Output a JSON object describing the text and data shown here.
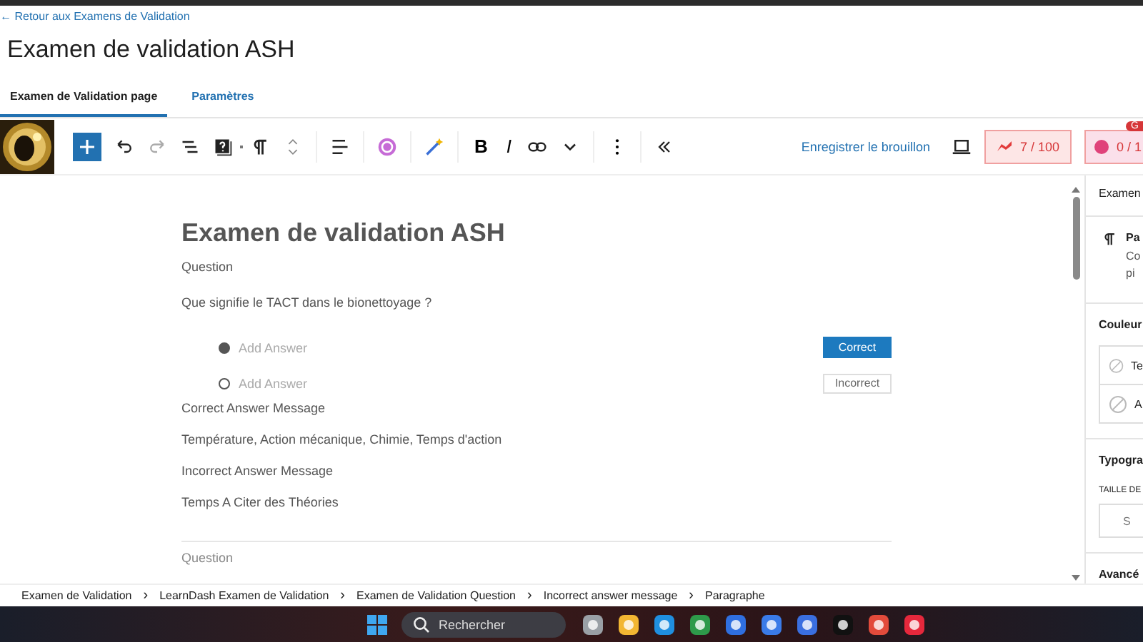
{
  "back_link": "← Retour aux Examens de Validation",
  "title": "Examen de validation ASH",
  "tabs": [
    {
      "label": "Examen de Validation page",
      "selected": true
    },
    {
      "label": "Paramètres",
      "selected": false
    }
  ],
  "toolbar": {
    "bold": "B",
    "italic": "I",
    "save_draft": "Enregistrer le brouillon",
    "score_1": "7 / 100",
    "score_2": "0 / 1",
    "badge": "G"
  },
  "editor": {
    "heading": "Examen de validation ASH",
    "question_label": "Question",
    "question": "Que signifie le TACT dans le bionettoyage ?",
    "answers": [
      {
        "placeholder": "Add Answer",
        "checked": true,
        "button": "Correct"
      },
      {
        "placeholder": "Add Answer",
        "checked": false,
        "button": "Incorrect"
      }
    ],
    "paragraphs": [
      "Correct Answer Message",
      "Température, Action mécanique, Chimie, Temps d'action",
      "Incorrect Answer Message",
      "Temps A Citer des Théories"
    ],
    "next_label": "Question"
  },
  "sidebar": {
    "tab": "Examen",
    "block_title": "Pa",
    "block_desc_1": "Co",
    "block_desc_2": "pi",
    "color_heading": "Couleur",
    "color_items": [
      "Te",
      "A"
    ],
    "typo_heading": "Typogra",
    "size_label": "TAILLE DE",
    "size_value": "S",
    "advanced": "Avancé"
  },
  "breadcrumb_separator": "›",
  "breadcrumb": [
    "Examen de Validation",
    "LearnDash Examen de Validation",
    "Examen de Validation Question",
    "Incorrect answer message",
    "Paragraphe"
  ],
  "taskbar": {
    "search": "Rechercher"
  }
}
